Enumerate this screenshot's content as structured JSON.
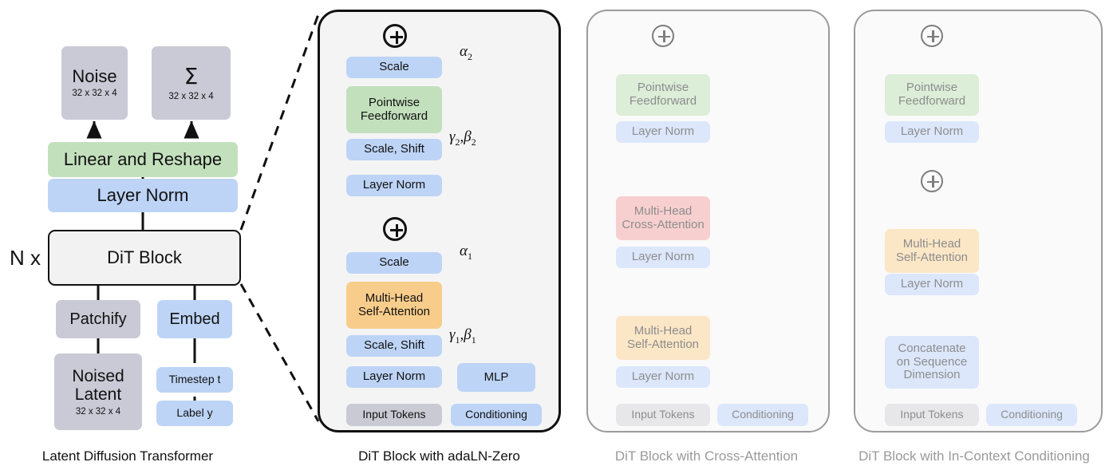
{
  "figure": {
    "title": "Diffusion Transformer (DiT) architecture variants"
  },
  "panels": [
    {
      "id": "latent-diffusion-transformer",
      "caption": "Latent Diffusion Transformer",
      "style": "solid",
      "nodes": {
        "noise": {
          "label": "Noise",
          "sub": "32 x 32 x 4",
          "color": "#c9cad5"
        },
        "sigma": {
          "label": "Σ",
          "sub": "32 x 32 x 4",
          "color": "#c9cad5"
        },
        "linear_reshape": {
          "label": "Linear and Reshape",
          "color": "#c3e0bd"
        },
        "layer_norm": {
          "label": "Layer Norm",
          "color": "#bdd4f6"
        },
        "dit_block": {
          "label": "DiT Block",
          "color": "#f2f2f3"
        },
        "repeat": {
          "label": "N x"
        },
        "patchify": {
          "label": "Patchify",
          "color": "#c9cad5"
        },
        "embed": {
          "label": "Embed",
          "color": "#bdd4f6"
        },
        "noised_latent": {
          "label_line1": "Noised",
          "label_line2": "Latent",
          "sub": "32 x 32 x 4",
          "color": "#c9cad5"
        },
        "timestep": {
          "label": "Timestep t",
          "color": "#bdd4f6"
        },
        "label": {
          "label": "Label y",
          "color": "#bdd4f6"
        }
      }
    },
    {
      "id": "dit-block-adaln-zero",
      "caption": "DiT Block with adaLN-Zero",
      "style": "solid",
      "nodes": {
        "scale2": {
          "label": "Scale",
          "color": "#bdd4f6"
        },
        "pointwise_ff": {
          "label_line1": "Pointwise",
          "label_line2": "Feedforward",
          "color": "#c3e0bd"
        },
        "scale_shift2": {
          "label": "Scale, Shift",
          "color": "#bdd4f6"
        },
        "layer_norm2": {
          "label": "Layer Norm",
          "color": "#bdd4f6"
        },
        "scale1": {
          "label": "Scale",
          "color": "#bdd4f6"
        },
        "mhsa": {
          "label_line1": "Multi-Head",
          "label_line2": "Self-Attention",
          "color": "#f8cd8b"
        },
        "scale_shift1": {
          "label": "Scale, Shift",
          "color": "#bdd4f6"
        },
        "layer_norm1": {
          "label": "Layer Norm",
          "color": "#bdd4f6"
        },
        "mlp": {
          "label": "MLP",
          "color": "#bdd4f6"
        },
        "input_tokens": {
          "label": "Input Tokens",
          "color": "#c9cad5"
        },
        "conditioning": {
          "label": "Conditioning",
          "color": "#bdd4f6"
        }
      },
      "annotations": {
        "alpha2": {
          "sym": "α",
          "sub": "2"
        },
        "gamma_beta2": {
          "sym": "γ",
          "sub": "2",
          "sym2": "β",
          "sub2": "2",
          "sep": ","
        },
        "alpha1": {
          "sym": "α",
          "sub": "1"
        },
        "gamma_beta1": {
          "sym": "γ",
          "sub": "1",
          "sym2": "β",
          "sub2": "1",
          "sep": ","
        }
      }
    },
    {
      "id": "dit-block-cross-attention",
      "caption": "DiT Block with Cross-Attention",
      "style": "faded",
      "nodes": {
        "pointwise_ff": {
          "label_line1": "Pointwise",
          "label_line2": "Feedforward",
          "color": "#dcedd8"
        },
        "layer_norm3": {
          "label": "Layer Norm",
          "color": "#dce7fb"
        },
        "mhca": {
          "label_line1": "Multi-Head",
          "label_line2": "Cross-Attention",
          "color": "#f8cfcf"
        },
        "layer_norm2": {
          "label": "Layer Norm",
          "color": "#dce7fb"
        },
        "mhsa": {
          "label_line1": "Multi-Head",
          "label_line2": "Self-Attention",
          "color": "#fbe6c6"
        },
        "layer_norm1": {
          "label": "Layer Norm",
          "color": "#dce7fb"
        },
        "input_tokens": {
          "label": "Input Tokens",
          "color": "#e7e7ea"
        },
        "conditioning": {
          "label": "Conditioning",
          "color": "#dce7fb"
        }
      }
    },
    {
      "id": "dit-block-in-context",
      "caption": "DiT Block with In-Context Conditioning",
      "style": "faded",
      "nodes": {
        "pointwise_ff": {
          "label_line1": "Pointwise",
          "label_line2": "Feedforward",
          "color": "#dcedd8"
        },
        "layer_norm2": {
          "label": "Layer Norm",
          "color": "#dce7fb"
        },
        "mhsa": {
          "label_line1": "Multi-Head",
          "label_line2": "Self-Attention",
          "color": "#fbe6c6"
        },
        "layer_norm1": {
          "label": "Layer Norm",
          "color": "#dce7fb"
        },
        "concat": {
          "label_line1": "Concatenate",
          "label_line2": "on Sequence",
          "label_line3": "Dimension",
          "color": "#dce7fb"
        },
        "input_tokens": {
          "label": "Input Tokens",
          "color": "#e7e7ea"
        },
        "conditioning": {
          "label": "Conditioning",
          "color": "#dce7fb"
        }
      }
    }
  ],
  "icons": {
    "residual_add": "plus-circle-icon"
  },
  "colors": {
    "stroke_solid": "#111111",
    "stroke_faded": "#7d7d7d",
    "panel_fill_solid": "#f4f4f5",
    "panel_fill_faded": "#fafafa"
  }
}
